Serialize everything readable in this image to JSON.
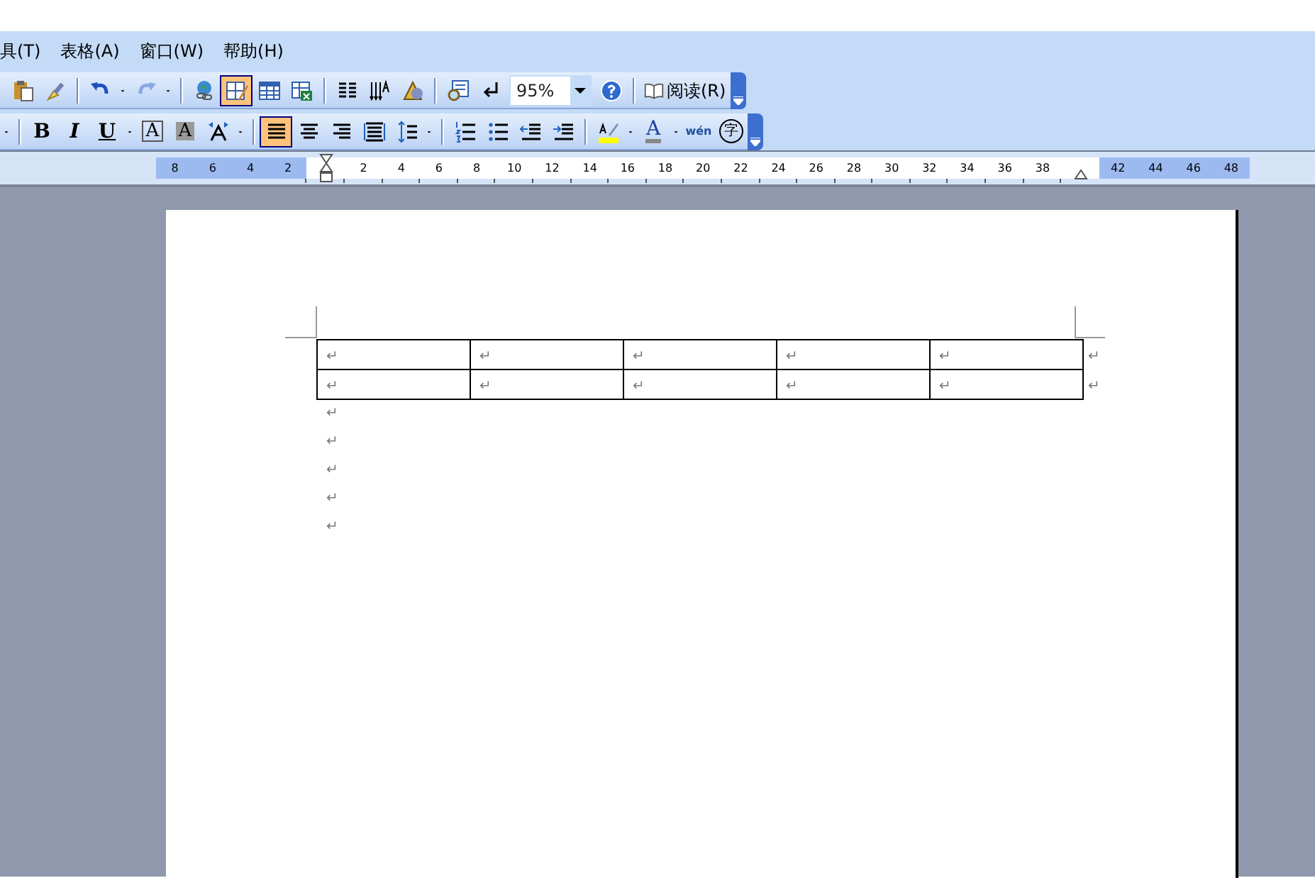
{
  "menu": [
    {
      "label": "具(T)"
    },
    {
      "label": "表格(A)"
    },
    {
      "label": "窗口(W)"
    },
    {
      "label": "帮助(H)"
    }
  ],
  "standard_toolbar": {
    "buttons": [
      {
        "selected": false,
        "disabled": false
      },
      {
        "selected": false,
        "disabled": false
      },
      {
        "selected": false,
        "disabled": false
      },
      {
        "selected": false,
        "disabled": true
      },
      {
        "selected": false,
        "disabled": false
      },
      {
        "selected": true,
        "disabled": false
      },
      {
        "selected": false,
        "disabled": false
      },
      {
        "selected": false,
        "disabled": false
      },
      {
        "selected": false,
        "disabled": false
      },
      {
        "selected": false,
        "disabled": false
      },
      {
        "selected": false,
        "disabled": false
      },
      {
        "selected": false,
        "disabled": false
      },
      {
        "selected": false,
        "disabled": false
      },
      {
        "selected": false,
        "disabled": false
      }
    ],
    "zoom": {
      "value": "95%"
    },
    "read_button": {
      "label": "阅读(R)"
    }
  },
  "formatting_toolbar": {
    "buttons": [
      {
        "label": "B",
        "selected": false
      },
      {
        "label": "I",
        "selected": false
      },
      {
        "label": "U",
        "selected": false
      },
      {
        "label": "A",
        "selected": false
      },
      {
        "label": "A",
        "selected": false
      },
      {
        "selected": false
      },
      {
        "selected": true
      },
      {
        "selected": false
      },
      {
        "selected": false
      },
      {
        "selected": false
      },
      {
        "selected": false
      },
      {
        "selected": false
      },
      {
        "selected": false
      },
      {
        "selected": false
      },
      {
        "selected": false
      },
      {
        "selected": false
      },
      {
        "label": "A",
        "selected": false
      },
      {
        "label": "wén",
        "selected": false
      },
      {
        "label": "字",
        "selected": false
      }
    ]
  },
  "ruler": {
    "left_numbers": [
      "8",
      "6",
      "4",
      "2"
    ],
    "numbers": [
      "2",
      "4",
      "6",
      "8",
      "10",
      "12",
      "14",
      "16",
      "18",
      "20",
      "22",
      "24",
      "26",
      "28",
      "30",
      "32",
      "34",
      "36",
      "38"
    ],
    "right_numbers": [
      "42",
      "44",
      "46",
      "48"
    ]
  },
  "document": {
    "table": {
      "rows": [
        [
          "↵",
          "↵",
          "↵",
          "↵",
          "↵"
        ],
        [
          "↵",
          "↵",
          "↵",
          "↵",
          "↵"
        ]
      ],
      "row_end_marks": [
        "↵",
        "↵"
      ]
    },
    "paragraphs": [
      "↵",
      "↵",
      "↵",
      "↵",
      "↵"
    ]
  }
}
